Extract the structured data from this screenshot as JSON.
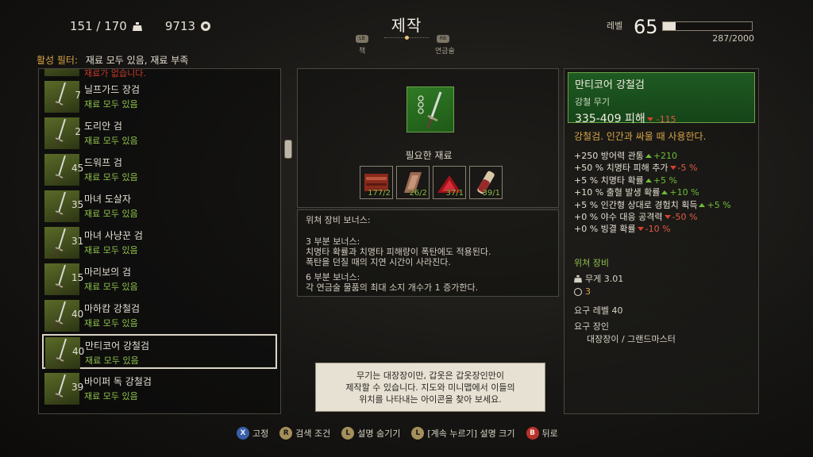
{
  "hud": {
    "inventory": "151 / 170",
    "crowns": "9713"
  },
  "header": {
    "title": "제작",
    "lb": "LB",
    "rb": "RB",
    "left_tab": "책",
    "right_tab": "연금술"
  },
  "level": {
    "label": "레벨",
    "value": "65",
    "xp": "287/2000",
    "xp_fraction": 0.1435
  },
  "filter": {
    "label": "활성 필터:",
    "value": "재료 모두 있음, 재료 부족"
  },
  "list": {
    "partial_status": "재료가 없습니다.",
    "items": [
      {
        "level": "7",
        "name": "닐프가드 장검",
        "status": "재료 모두 있음"
      },
      {
        "level": "2",
        "name": "도리안 검",
        "status": "재료 모두 있음"
      },
      {
        "level": "45",
        "name": "드워프 검",
        "status": "재료 모두 있음"
      },
      {
        "level": "35",
        "name": "마녀 도살자",
        "status": "재료 모두 있음"
      },
      {
        "level": "31",
        "name": "마녀 사냥꾼 검",
        "status": "재료 모두 있음"
      },
      {
        "level": "15",
        "name": "마리보의 검",
        "status": "재료 모두 있음"
      },
      {
        "level": "40",
        "name": "마하캄 강철검",
        "status": "재료 모두 있음"
      },
      {
        "level": "40",
        "name": "만티코어 강철검",
        "status": "재료 모두 있음"
      },
      {
        "level": "39",
        "name": "바이퍼 독 강철검",
        "status": "재료 모두 있음"
      }
    ]
  },
  "craft": {
    "required_title": "필요한 재료",
    "materials": [
      {
        "count": "177/2",
        "icon": "leather-icon"
      },
      {
        "count": "26/2",
        "icon": "steel-plate-icon"
      },
      {
        "count": "37/1",
        "icon": "ruby-dust-icon"
      },
      {
        "count": "39/1",
        "icon": "oil-vial-icon"
      }
    ]
  },
  "bonus": {
    "title": "위쳐 장비 보너스:",
    "three_title": "3 부분 보너스:",
    "three_line1": "치명타 확률과 치명타 피해량이 폭탄에도 적용된다.",
    "three_line2": "폭탄을 던질 때의 지연 시간이 사라진다.",
    "six_title": "6 부분 보너스:",
    "six_line1": "각 연금술 물품의 최대 소지 개수가 1 증가한다."
  },
  "tooltip": {
    "line1": "무기는 대장장이만, 갑옷은 갑옷장인만이",
    "line2": "제작할 수 있습니다. 지도와 미니맵에서 이들의",
    "line3": "위치를 나타내는 아이콘을 찾아 보세요."
  },
  "details": {
    "name": "만티코어 강철검",
    "type": "강철 무기",
    "damage": "335-409 피해",
    "damage_diff": "-115",
    "description": "강철검. 인간과 싸울 때 사용한다.",
    "stats": [
      {
        "text": "+250 방어력 관통",
        "diff": "+210",
        "dir": "up"
      },
      {
        "text": "+50 % 치명타 피해 추가",
        "diff": "-5 %",
        "dir": "down"
      },
      {
        "text": "+5 % 치명타 확률",
        "diff": "+5 %",
        "dir": "up"
      },
      {
        "text": "+10 % 출혈 발생 확률",
        "diff": "+10 %",
        "dir": "up"
      },
      {
        "text": "+5 % 인간형 상대로 경험치 획득",
        "diff": "+5 %",
        "dir": "up"
      },
      {
        "text": "+0 % 야수 대응 공격력",
        "diff": "-50 %",
        "dir": "down"
      },
      {
        "text": "+0 % 빙결 확률",
        "diff": "-10 %",
        "dir": "down"
      }
    ],
    "witcher_gear": "위쳐 장비",
    "weight": "무게  3.01",
    "sockets": "3",
    "required_level": "요구 레벨 40",
    "required_crafter_label": "요구 장인",
    "required_crafter_value": "대장장이 / 그랜드마스터"
  },
  "hints": [
    {
      "key": "X",
      "label": "고정"
    },
    {
      "key": "R",
      "label": "검색 조건"
    },
    {
      "key": "L",
      "label": "설명 숨기기"
    },
    {
      "key": "L",
      "label": "[계속 누르기] 설명 크기"
    },
    {
      "key": "B",
      "label": "뒤로"
    }
  ],
  "colors": {
    "status_green": "#8fc24a",
    "status_red": "#c63a2b",
    "filter_gold": "#d8a548",
    "panel_green": "#1f5a22"
  }
}
